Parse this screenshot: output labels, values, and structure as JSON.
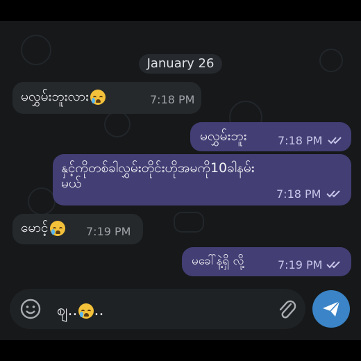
{
  "chat": {
    "date_label": "January 26",
    "messages": [
      {
        "direction": "in",
        "text": "မလွှမ်းဘူးလား",
        "emoji": "loudly-crying-face",
        "time": "7:18 PM"
      },
      {
        "direction": "out",
        "text": "မလွှမ်းဘူး",
        "time": "7:18 PM",
        "status": "read"
      },
      {
        "direction": "out",
        "text_line1": "နှင့်ကိုတစ်ခါလွှမ်းတိုင်းဟိုအမကို10ခါနမ်း",
        "text_line2": "မယ်",
        "time": "7:18 PM",
        "status": "read"
      },
      {
        "direction": "in",
        "text": "မောင့်",
        "emoji": "loudly-crying-face",
        "time": "7:19 PM"
      },
      {
        "direction": "out",
        "text": "မခေါ်နဲ့ရှိ လို့",
        "time": "7:19 PM",
        "status": "read"
      }
    ]
  },
  "composer": {
    "text": "ဈ..",
    "emoji": "loudly-crying-face",
    "trailing": "..",
    "emoji_button_icon": "smiley-icon",
    "attach_icon": "paperclip-icon",
    "send_icon": "send-icon"
  },
  "colors": {
    "background": "#16181a",
    "incoming_bubble": "#26292c",
    "outgoing_bubble": "#433e74",
    "send_button": "#3a84c7"
  }
}
